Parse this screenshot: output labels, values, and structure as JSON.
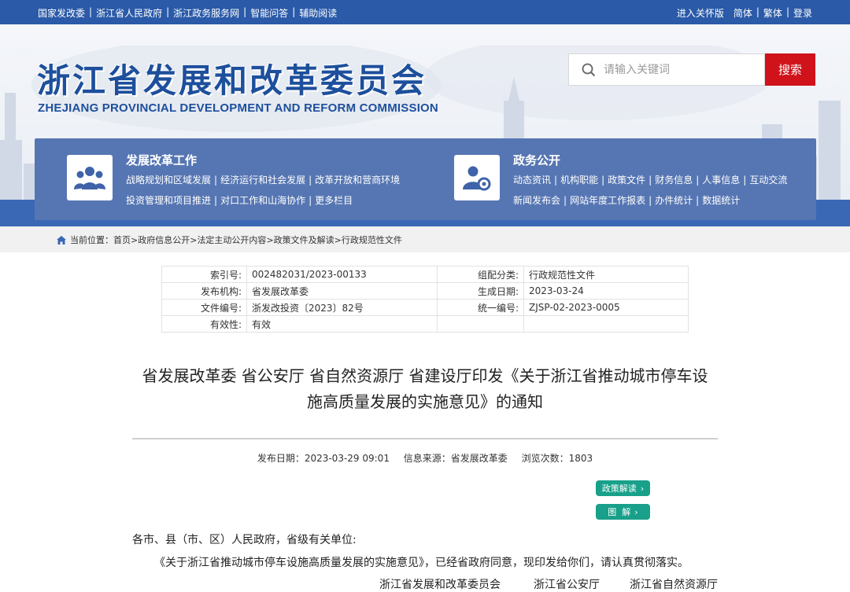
{
  "topbar": {
    "left_links": [
      "国家发改委",
      "浙江省人民政府",
      "浙江政务服务网",
      "智能问答",
      "辅助阅读"
    ],
    "right_links": [
      "进入关怀版",
      "简体",
      "繁体",
      "登录"
    ]
  },
  "header": {
    "title_cn": "浙江省发展和改革委员会",
    "title_en": "ZHEJIANG PROVINCIAL DEVELOPMENT AND REFORM COMMISSION",
    "search_placeholder": "请输入关键词",
    "search_button": "搜索"
  },
  "nav": {
    "section1": {
      "title": "发展改革工作",
      "row1": [
        "战略规划和区域发展",
        "经济运行和社会发展",
        "改革开放和营商环境"
      ],
      "row2": [
        "投资管理和项目推进",
        "对口工作和山海协作",
        "更多栏目"
      ]
    },
    "section2": {
      "title": "政务公开",
      "row1": [
        "动态资讯",
        "机构职能",
        "政策文件",
        "财务信息",
        "人事信息",
        "互动交流"
      ],
      "row2": [
        "新闻发布会",
        "网站年度工作报表",
        "办件统计",
        "数据统计"
      ]
    }
  },
  "breadcrumb": {
    "prefix": "当前位置：",
    "items": [
      "首页",
      "政府信息公开",
      "法定主动公开内容",
      "政策文件及解读",
      "行政规范性文件"
    ]
  },
  "meta": {
    "index_no_label": "索引号:",
    "index_no": "002482031/2023-00133",
    "category_label": "组配分类:",
    "category": "行政规范性文件",
    "publisher_label": "发布机构:",
    "publisher": "省发展改革委",
    "created_label": "生成日期:",
    "created": "2023-03-24",
    "doc_no_label": "文件编号:",
    "doc_no": "浙发改投资〔2023〕82号",
    "unified_label": "统一编号:",
    "unified": "ZJSP-02-2023-0005",
    "validity_label": "有效性:",
    "validity": "有效"
  },
  "article": {
    "title_line1": "省发展改革委 省公安厅 省自然资源厅 省建设厅印发《关于浙江省推动城市停车设",
    "title_line2": "施高质量发展的实施意见》的通知",
    "date": "发布日期：2023-03-29 09:01",
    "source": "信息来源：省发展改革委",
    "views": "浏览次数：1803",
    "btn_policy": "政策解读",
    "btn_graphic": "图  解",
    "salutation": "各市、县（市、区）人民政府，省级有关单位:",
    "para1": "《关于浙江省推动城市停车设施高质量发展的实施意见》，已经省政府同意，现印发给你们，请认真贯彻落实。",
    "sign1": "浙江省发展和改革委员会",
    "sign2": "浙江省公安厅",
    "sign3": "浙江省自然资源厅"
  }
}
